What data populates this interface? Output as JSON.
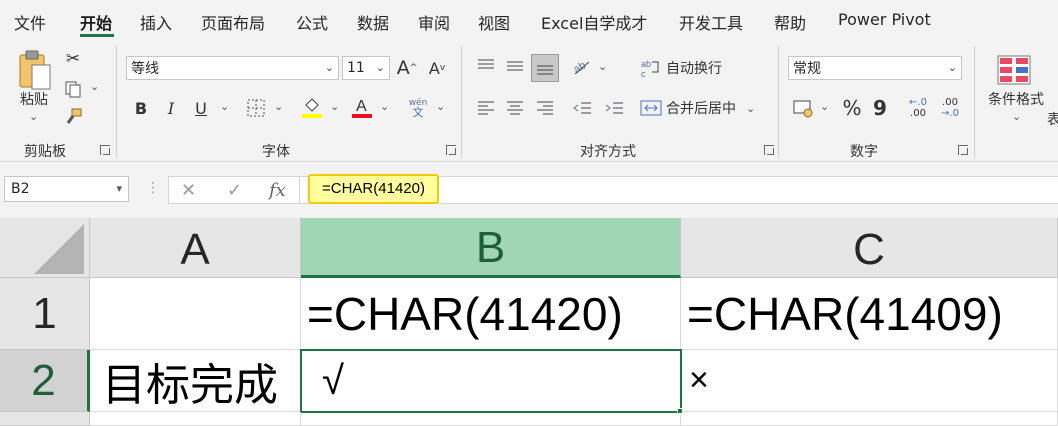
{
  "tabs": [
    "文件",
    "开始",
    "插入",
    "页面布局",
    "公式",
    "数据",
    "审阅",
    "视图",
    "Excel自学成才",
    "开发工具",
    "帮助",
    "Power Pivot"
  ],
  "active_tab": "开始",
  "ribbon": {
    "clipboard": {
      "paste_label": "粘贴",
      "group_label": "剪贴板"
    },
    "font": {
      "font_name": "等线",
      "font_size": "11",
      "grow": "A",
      "shrink": "A",
      "bold": "B",
      "italic": "I",
      "underline": "U",
      "pinyin_top": "wén",
      "pinyin_bottom": "文",
      "group_label": "字体"
    },
    "alignment": {
      "wrap_label": "自动换行",
      "merge_label": "合并后居中",
      "group_label": "对齐方式"
    },
    "number": {
      "format": "常规",
      "percent": "%",
      "comma": "9",
      "inc_top": "←.0",
      "inc_bottom": ".00",
      "dec_top": ".00",
      "dec_bottom": "→.0",
      "group_label": "数字"
    },
    "styles": {
      "conditional_label": "条件格式",
      "partial": "表"
    }
  },
  "formula_bar": {
    "name_box": "B2",
    "cancel": "✕",
    "enter": "✓",
    "fx": "fx",
    "formula": "=CHAR(41420)"
  },
  "grid": {
    "columns": [
      "A",
      "B",
      "C"
    ],
    "rows": [
      "1",
      "2"
    ],
    "cells": {
      "B1": "=CHAR(41420)",
      "C1": "=CHAR(41409)",
      "A2": "目标完成",
      "B2": "√",
      "C2": "×"
    },
    "active_cell": "B2"
  },
  "colors": {
    "accent": "#217346",
    "highlight": "#ffff9e",
    "highlight_border": "#f2c811",
    "font_color": "#e81123",
    "fill_color": "#ffff00"
  }
}
